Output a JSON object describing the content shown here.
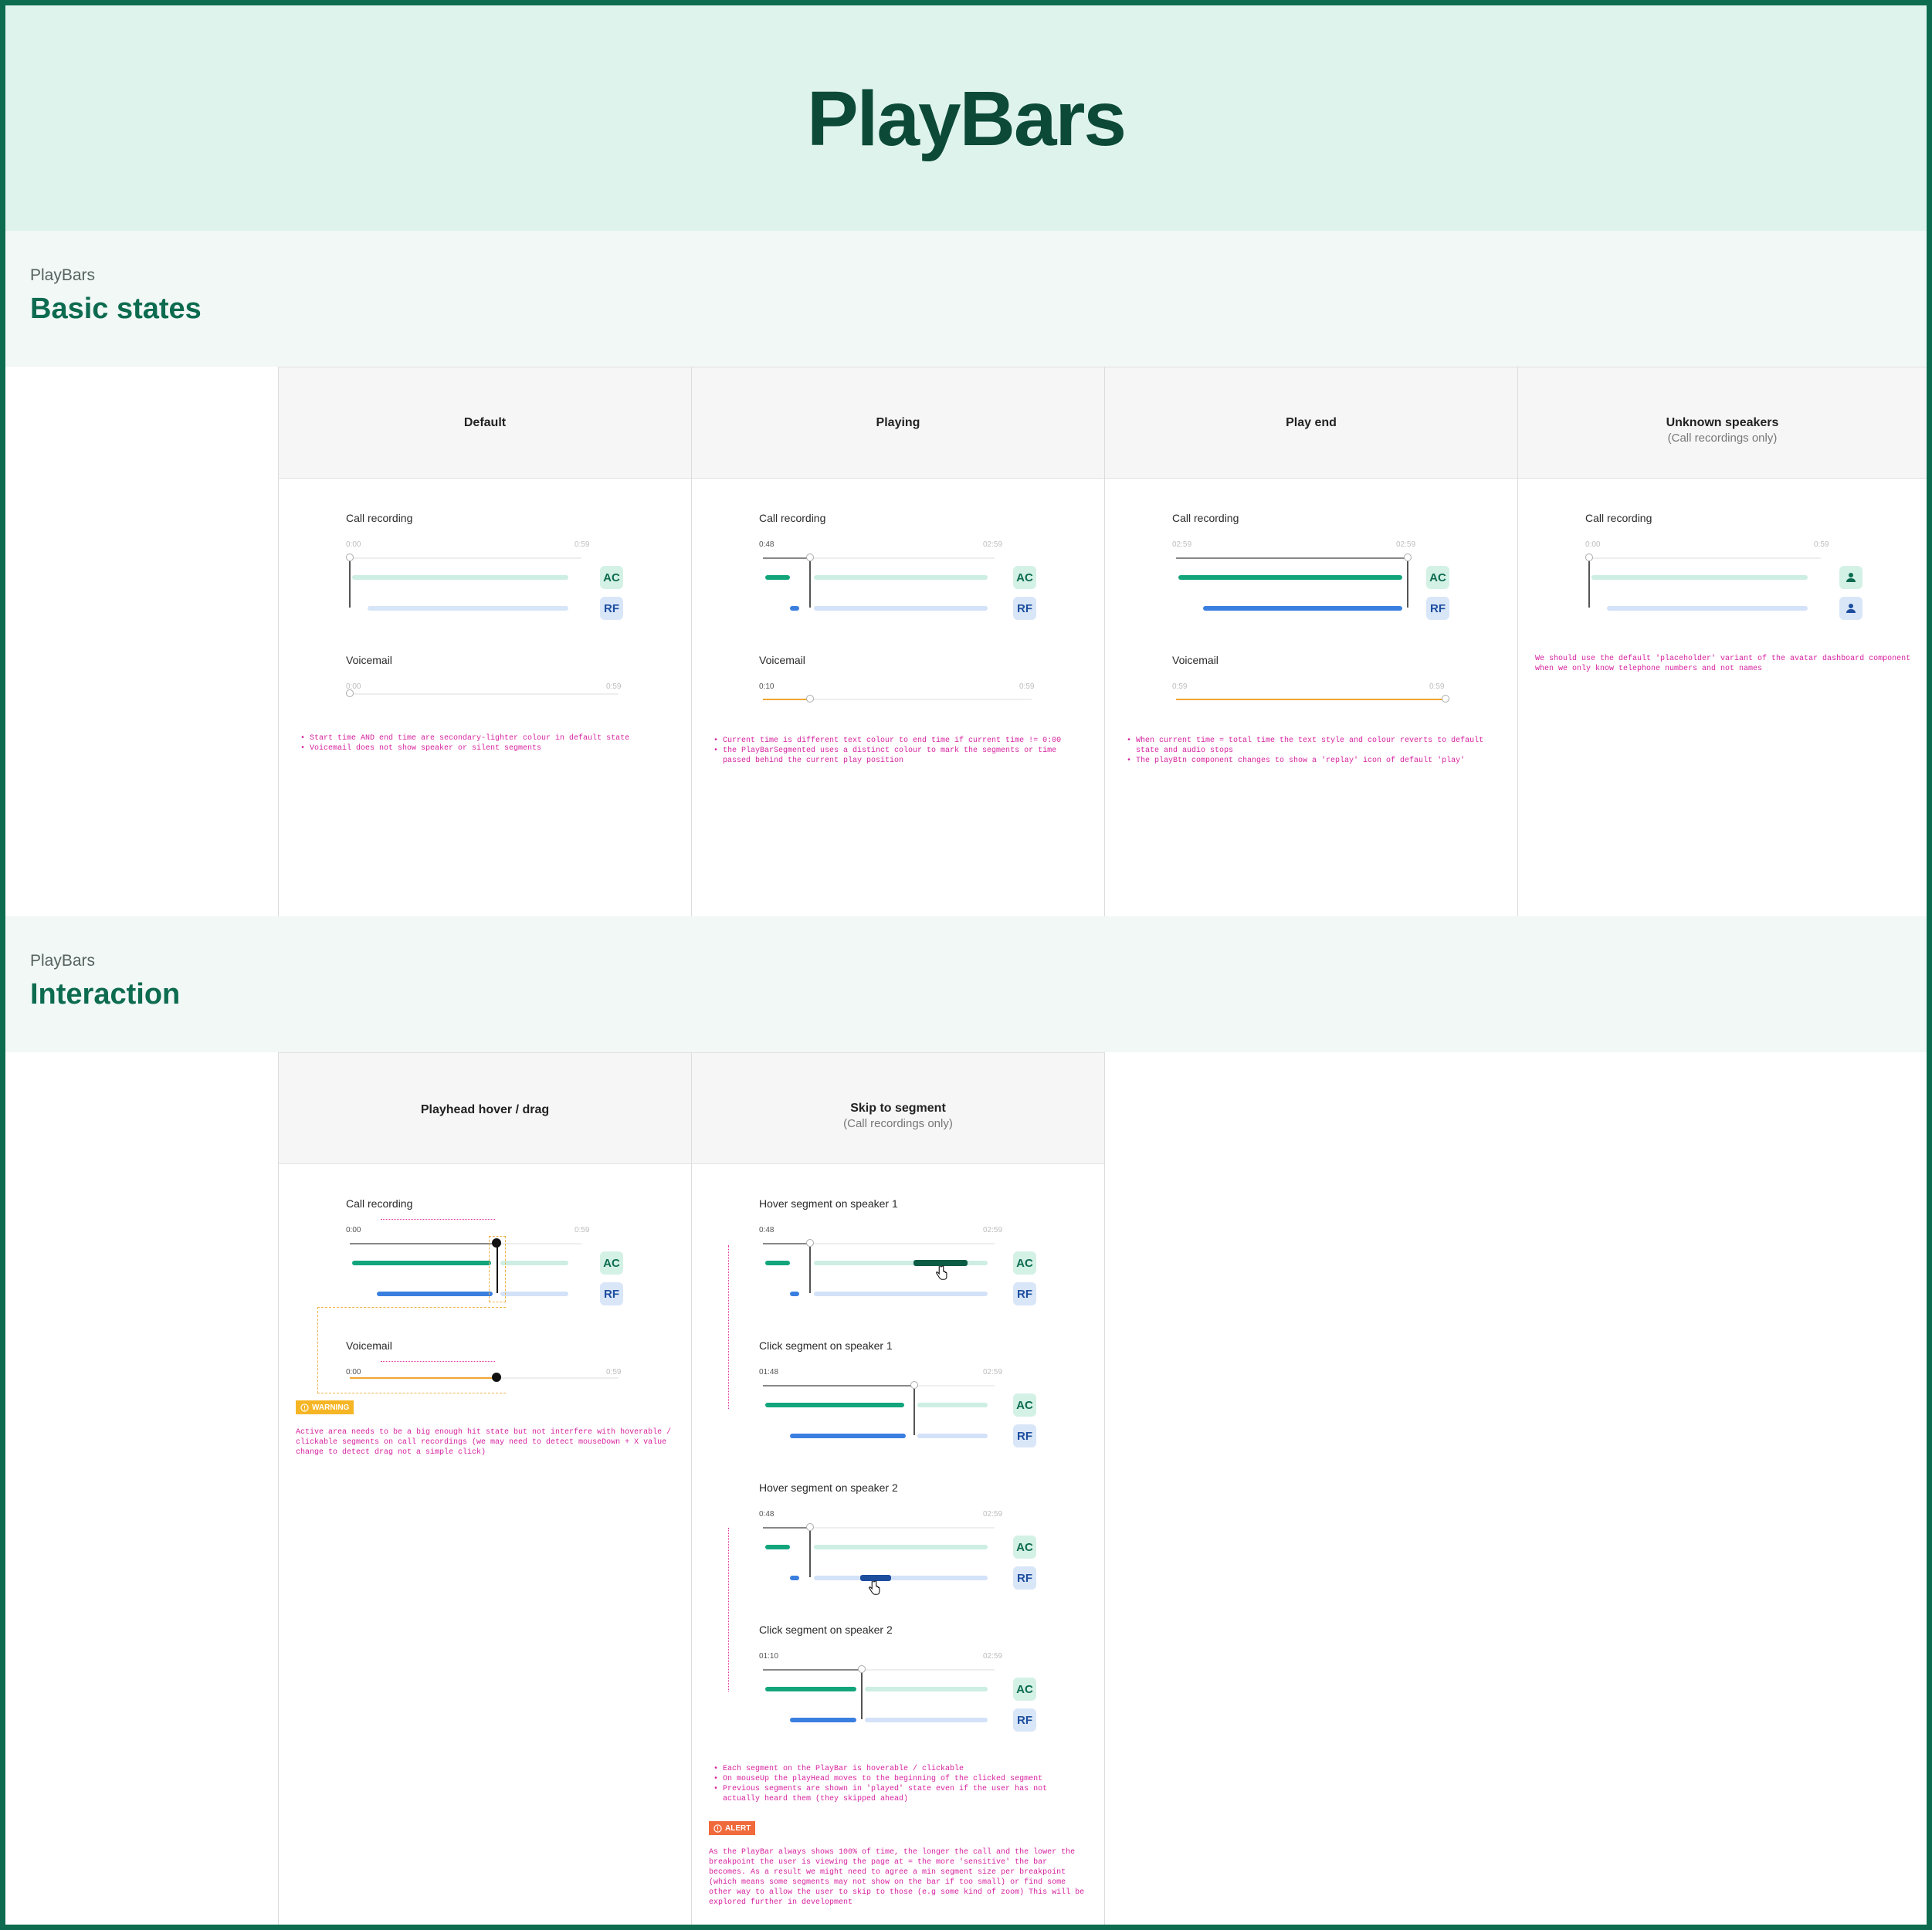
{
  "page_title": "PlayBars",
  "sections": {
    "basic": {
      "sub": "PlayBars",
      "title": "Basic states"
    },
    "interaction": {
      "sub": "PlayBars",
      "title": "Interaction"
    }
  },
  "columns": {
    "default": {
      "title": "Default"
    },
    "playing": {
      "title": "Playing"
    },
    "play_end": {
      "title": "Play end"
    },
    "unknown": {
      "title": "Unknown speakers",
      "subtitle": "(Call recordings only)"
    },
    "hover_drag": {
      "title": "Playhead hover / drag"
    },
    "skip": {
      "title": "Skip to segment",
      "subtitle": "(Call recordings only)"
    }
  },
  "labels": {
    "call_recording": "Call recording",
    "voicemail": "Voicemail",
    "hover_spk1": "Hover segment on speaker 1",
    "click_spk1": "Click segment on speaker 1",
    "hover_spk2": "Hover segment on speaker 2",
    "click_spk2": "Click segment on speaker 2"
  },
  "speakers": {
    "ac": "AC",
    "rf": "RF"
  },
  "times": {
    "zero": "0:00",
    "end_059": "0:59",
    "t048": "0:48",
    "end_0259": "02:59",
    "t010": "0:10",
    "t0148": "01:48",
    "t0110": "01:10"
  },
  "badges": {
    "warning": "WARNING",
    "alert": "ALERT"
  },
  "notes": {
    "default": "• Start time AND end time are secondary-lighter colour in default state\n• Voicemail does not show speaker or silent segments",
    "playing": "• Current time is different text colour to end time if current time != 0:00\n• the PlayBarSegmented uses a distinct colour to mark the segments or time\n  passed behind the current play position",
    "play_end": "• When current time = total time the text style and colour reverts to default\n  state and audio stops\n• The playBtn component changes to show a 'replay' icon of default 'play'",
    "unknown": "We should use the default 'placeholder' variant of the avatar dashboard component\nwhen we only know telephone numbers and not names",
    "hover_drag": "Active area needs to be a big enough hit state but not interfere with hoverable /\nclickable segments on call recordings (we may need to detect mouseDown + X value\nchange to detect drag not a simple click)",
    "skip": "• Each segment on the PlayBar is hoverable / clickable\n• On mouseUp the playHead moves to the beginning of the clicked segment\n• Previous segments are shown in 'played' state even if the user has not\n  actually heard them (they skipped ahead)",
    "alert": "As the PlayBar always shows 100% of time, the longer the call and the lower the\nbreakpoint the user is viewing the page at = the more 'sensitive' the bar\nbecomes. As a result we might need to agree a min segment size per breakpoint\n(which means some segments may not show on the bar if too small) or find some\nother way to allow the user to skip to those (e.g some kind of zoom) This will be\nexplored further in development"
  },
  "colors": {
    "brand": "#0d6b4f",
    "speaker1": "#12a57c",
    "speaker2": "#3a7fe0",
    "voicemail_played": "#f0a531",
    "note": "#d6219e",
    "warning": "#f5b524",
    "alert": "#f06a3c"
  },
  "icons": [
    "warning-icon",
    "alert-icon",
    "hand-cursor-icon",
    "person-placeholder-icon"
  ]
}
